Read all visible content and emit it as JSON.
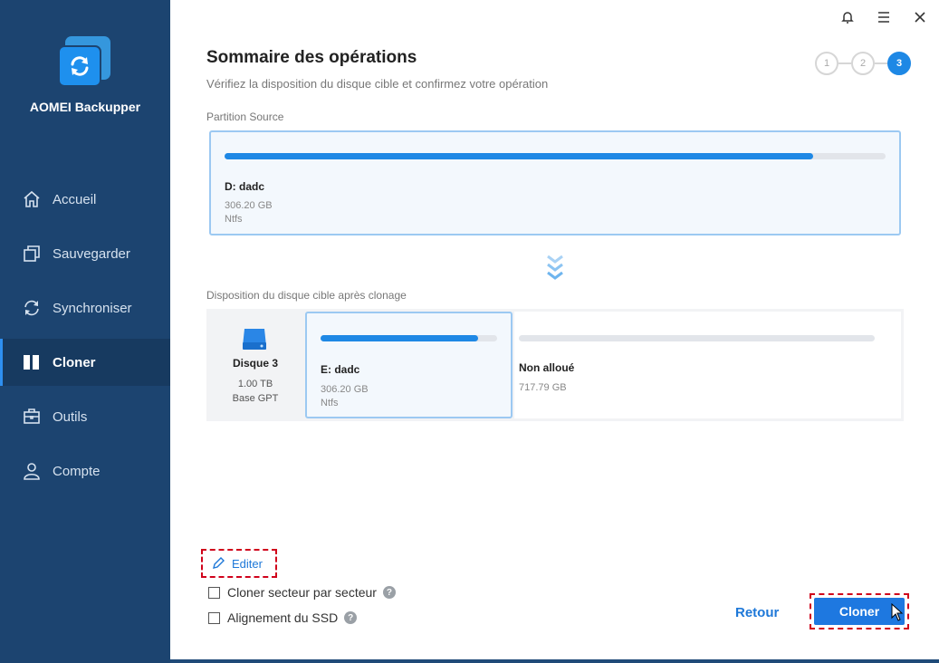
{
  "app": {
    "title": "AOMEI Backupper"
  },
  "window": {
    "icons": [
      "bell-icon",
      "menu-icon",
      "close-icon"
    ]
  },
  "nav": [
    {
      "id": "accueil",
      "label": "Accueil",
      "icon": "home-icon"
    },
    {
      "id": "sauvegarder",
      "label": "Sauvegarder",
      "icon": "backup-icon"
    },
    {
      "id": "synchroniser",
      "label": "Synchroniser",
      "icon": "sync-icon"
    },
    {
      "id": "cloner",
      "label": "Cloner",
      "icon": "clone-icon",
      "active": true
    },
    {
      "id": "outils",
      "label": "Outils",
      "icon": "toolbox-icon"
    },
    {
      "id": "compte",
      "label": "Compte",
      "icon": "user-icon"
    }
  ],
  "header": {
    "title": "Sommaire des opérations",
    "subtitle": "Vérifiez la disposition du disque cible et confirmez votre opération"
  },
  "steps": {
    "items": [
      "1",
      "2",
      "3"
    ],
    "current": 3
  },
  "source": {
    "label": "Partition Source",
    "partition": {
      "name": "D: dadc",
      "size": "306.20 GB",
      "fs": "Ntfs",
      "used_fraction": 0.89
    }
  },
  "target": {
    "label": "Disposition du disque cible après clonage",
    "disk": {
      "name": "Disque 3",
      "size": "1.00 TB",
      "type": "Base GPT"
    },
    "partition": {
      "name": "E: dadc",
      "size": "306.20 GB",
      "fs": "Ntfs",
      "used_fraction": 0.89
    },
    "unallocated": {
      "name": "Non alloué",
      "size": "717.79 GB",
      "used_fraction": 0
    }
  },
  "actions": {
    "edit_label": "Editer",
    "sector_clone_label": "Cloner secteur par secteur",
    "ssd_align_label": "Alignement du SSD",
    "help_glyph": "?",
    "back_label": "Retour",
    "clone_label": "Cloner"
  },
  "colors": {
    "accent": "#1e88e5",
    "sidebar": "#1c4470",
    "highlight": "#d0021b"
  }
}
